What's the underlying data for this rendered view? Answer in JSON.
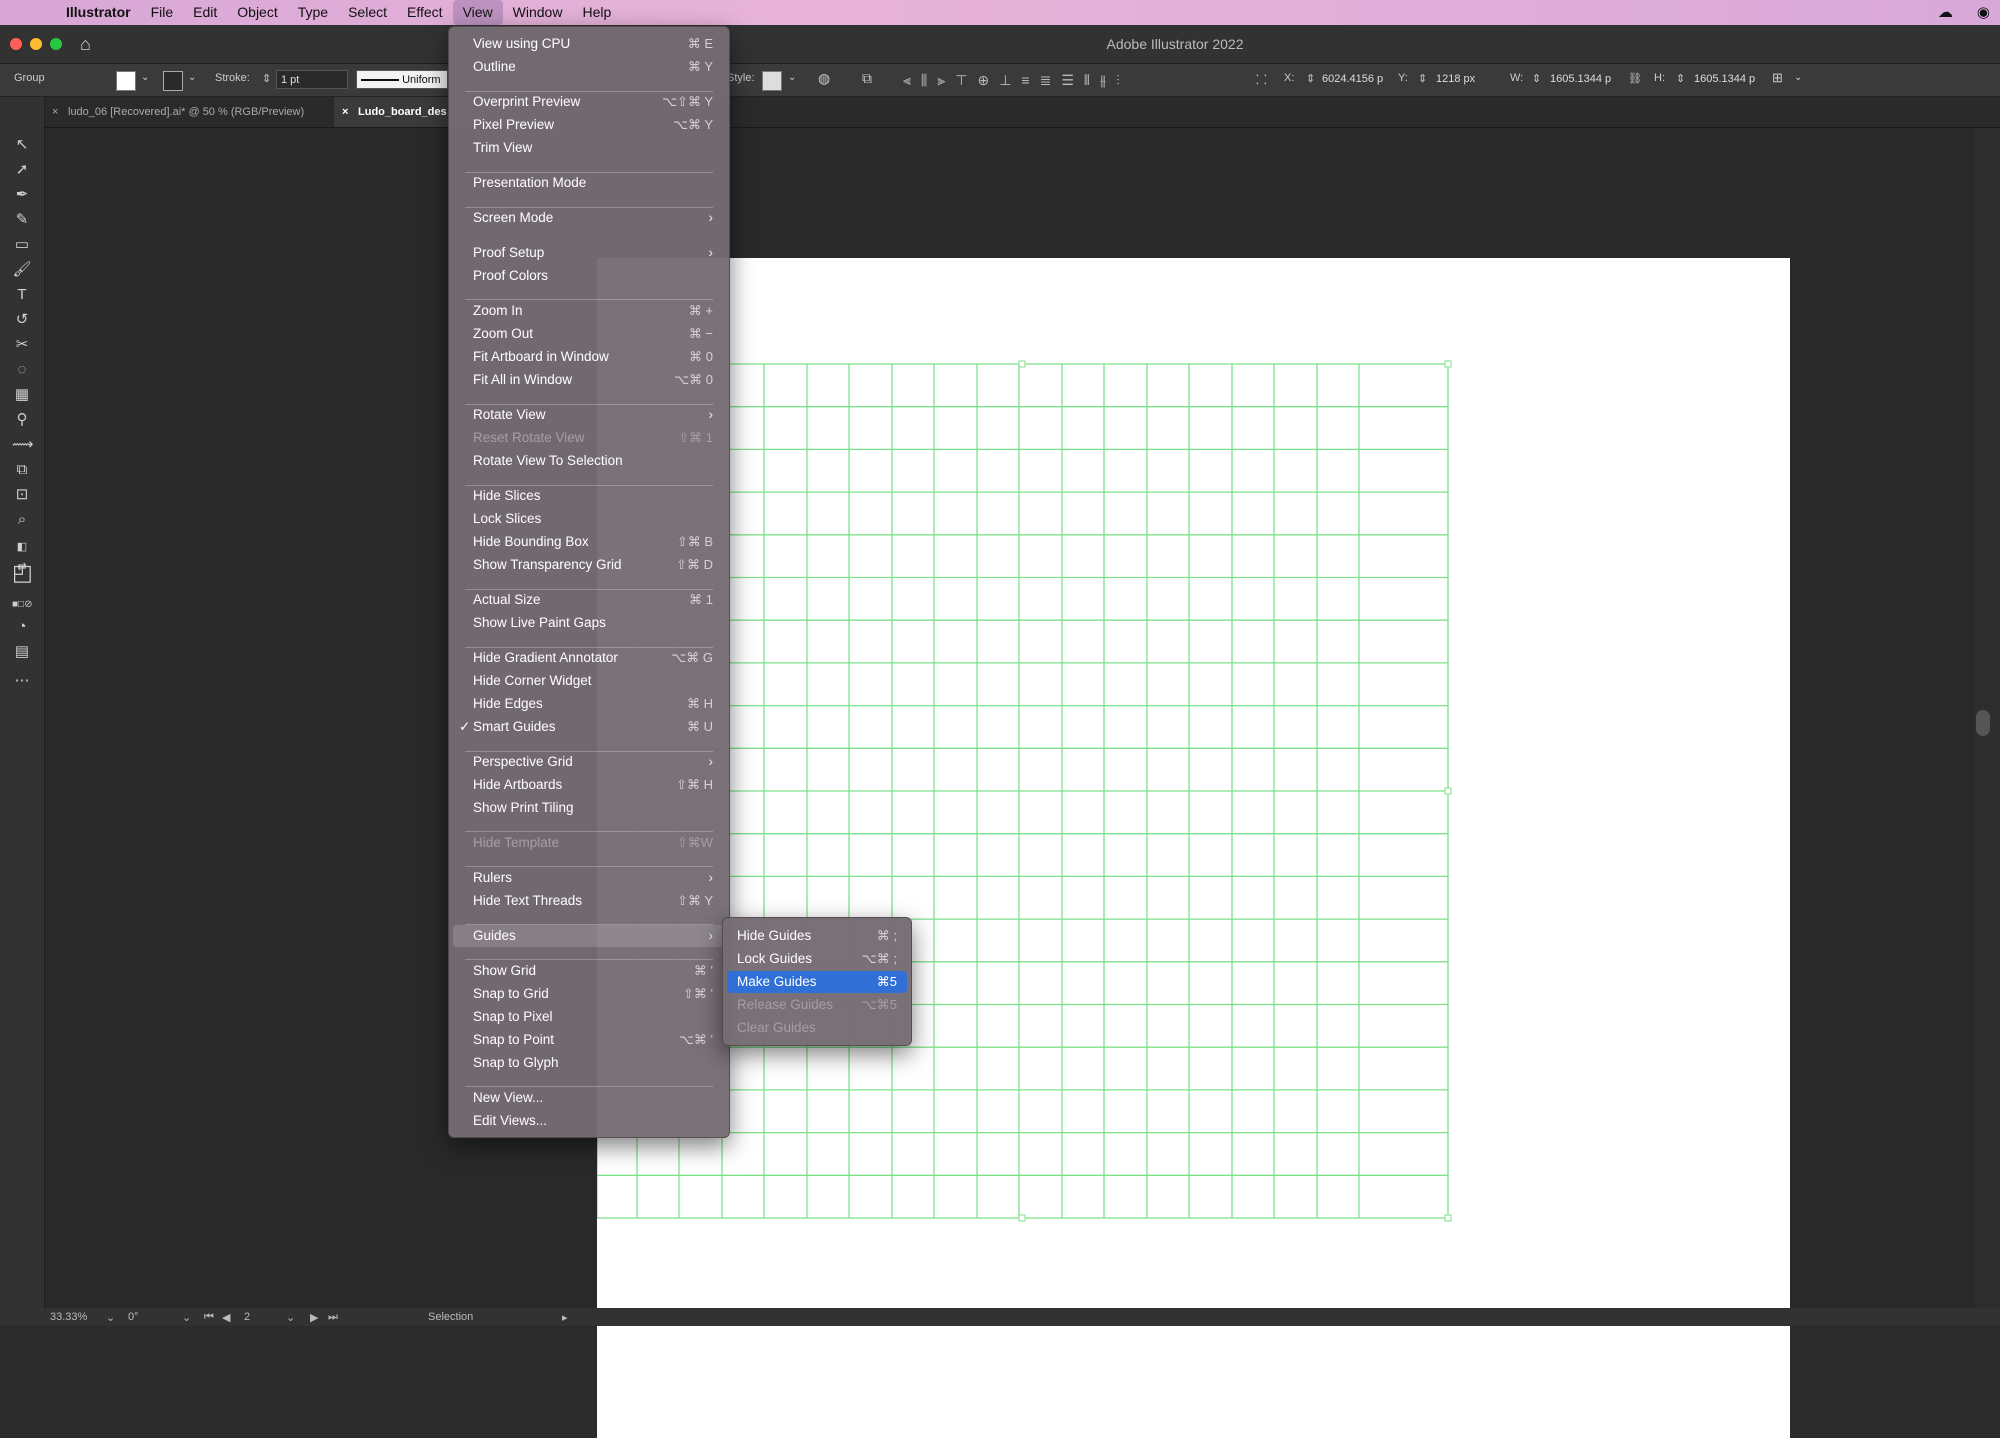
{
  "menubar": {
    "app_name": "Illustrator",
    "items": [
      "File",
      "Edit",
      "Object",
      "Type",
      "Select",
      "Effect",
      "View",
      "Window",
      "Help"
    ]
  },
  "window": {
    "title": "Adobe Illustrator 2022"
  },
  "controlbar": {
    "selection_type": "Group",
    "stroke_label": "Stroke:",
    "stroke_value": "1 pt",
    "profile_label": "Uniform",
    "style_label": "Style:",
    "x_label": "X:",
    "x_value": "6024.4156 p",
    "y_label": "Y:",
    "y_value": "1218 px",
    "w_label": "W:",
    "w_value": "1605.1344 p",
    "h_label": "H:",
    "h_value": "1605.1344 p"
  },
  "tabs": [
    {
      "label": "ludo_06 [Recovered].ai* @ 50 % (RGB/Preview)"
    },
    {
      "label": "Ludo_board_des"
    }
  ],
  "statusbar": {
    "zoom": "33.33%",
    "rotation": "0°",
    "artboard_num": "2",
    "tool": "Selection"
  },
  "view_menu": {
    "items": [
      {
        "label": "View using CPU",
        "shortcut": "⌘ E"
      },
      {
        "label": "Outline",
        "shortcut": "⌘ Y"
      },
      {
        "label": "Overprint Preview",
        "shortcut": "⌥⇧⌘ Y"
      },
      {
        "label": "Pixel Preview",
        "shortcut": "⌥⌘ Y"
      },
      {
        "label": "Trim View",
        "shortcut": ""
      },
      {
        "label": "Presentation Mode",
        "shortcut": ""
      },
      {
        "label": "Screen Mode",
        "shortcut": ""
      },
      {
        "label": "Proof Setup",
        "shortcut": ""
      },
      {
        "label": "Proof Colors",
        "shortcut": ""
      },
      {
        "label": "Zoom In",
        "shortcut": "⌘ +"
      },
      {
        "label": "Zoom Out",
        "shortcut": "⌘ −"
      },
      {
        "label": "Fit Artboard in Window",
        "shortcut": "⌘ 0"
      },
      {
        "label": "Fit All in Window",
        "shortcut": "⌥⌘ 0"
      },
      {
        "label": "Rotate View",
        "shortcut": ""
      },
      {
        "label": "Reset Rotate View",
        "shortcut": "⇧⌘ 1"
      },
      {
        "label": "Rotate View To Selection",
        "shortcut": ""
      },
      {
        "label": "Hide Slices",
        "shortcut": ""
      },
      {
        "label": "Lock Slices",
        "shortcut": ""
      },
      {
        "label": "Hide Bounding Box",
        "shortcut": "⇧⌘ B"
      },
      {
        "label": "Show Transparency Grid",
        "shortcut": "⇧⌘ D"
      },
      {
        "label": "Actual Size",
        "shortcut": "⌘ 1"
      },
      {
        "label": "Show Live Paint Gaps",
        "shortcut": ""
      },
      {
        "label": "Hide Gradient Annotator",
        "shortcut": "⌥⌘ G"
      },
      {
        "label": "Hide Corner Widget",
        "shortcut": ""
      },
      {
        "label": "Hide Edges",
        "shortcut": "⌘ H"
      },
      {
        "label": "Smart Guides",
        "shortcut": "⌘ U",
        "checked": "✓"
      },
      {
        "label": "Perspective Grid",
        "shortcut": ""
      },
      {
        "label": "Hide Artboards",
        "shortcut": "⇧⌘ H"
      },
      {
        "label": "Show Print Tiling",
        "shortcut": ""
      },
      {
        "label": "Hide Template",
        "shortcut": "⇧⌘W"
      },
      {
        "label": "Rulers",
        "shortcut": ""
      },
      {
        "label": "Hide Text Threads",
        "shortcut": "⇧⌘ Y"
      },
      {
        "label": "Guides",
        "shortcut": ""
      },
      {
        "label": "Show Grid",
        "shortcut": "⌘ '"
      },
      {
        "label": "Snap to Grid",
        "shortcut": "⇧⌘ '"
      },
      {
        "label": "Snap to Pixel",
        "shortcut": ""
      },
      {
        "label": "Snap to Point",
        "shortcut": "⌥⌘ '"
      },
      {
        "label": "Snap to Glyph",
        "shortcut": ""
      },
      {
        "label": "New View...",
        "shortcut": ""
      },
      {
        "label": "Edit Views...",
        "shortcut": ""
      }
    ]
  },
  "guides_submenu": {
    "items": [
      {
        "label": "Hide Guides",
        "shortcut": "⌘ ;"
      },
      {
        "label": "Lock Guides",
        "shortcut": "⌥⌘ ;"
      },
      {
        "label": "Make Guides",
        "shortcut": "⌘5"
      },
      {
        "label": "Release Guides",
        "shortcut": "⌥⌘5"
      },
      {
        "label": "Clear Guides",
        "shortcut": ""
      }
    ]
  },
  "colors": {
    "grid_line": "#7fe08a",
    "selection_blue": "#2f6fd6",
    "menubar_tint": "#e0b0d8"
  }
}
